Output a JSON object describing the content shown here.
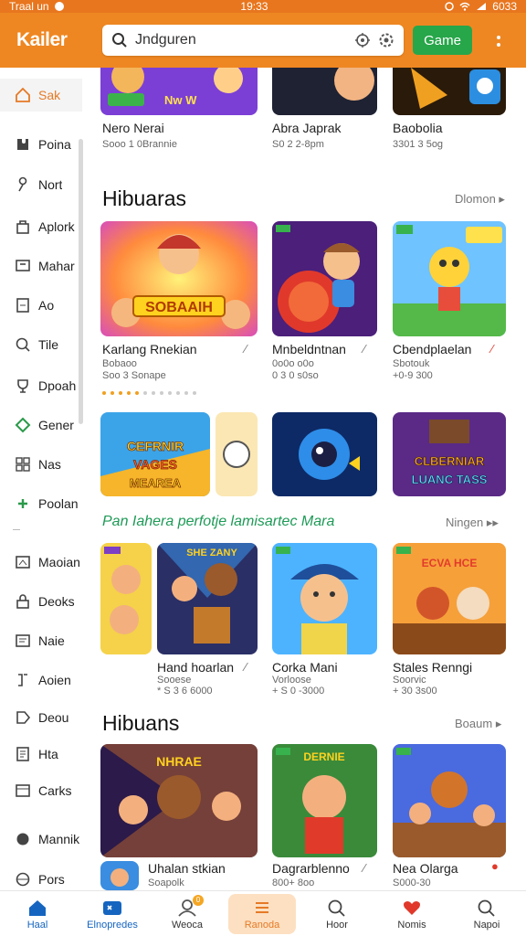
{
  "status_bar": {
    "left": "Traal un",
    "time": "19:33",
    "right": "6033"
  },
  "header": {
    "brand": "Kailer",
    "search": {
      "value": "",
      "placeholder": "Jndguren"
    },
    "game_button": "Game"
  },
  "sidebar": {
    "items": [
      {
        "label": "Sak",
        "icon": "home-icon",
        "active": true
      },
      {
        "label": "Poina",
        "icon": "puzzle-icon"
      },
      {
        "label": "Nort",
        "icon": "person-icon"
      },
      {
        "label": "Aplork",
        "icon": "bag-icon"
      },
      {
        "label": "Mahar",
        "icon": "screen-icon"
      },
      {
        "label": "Ao",
        "icon": "page-icon"
      },
      {
        "label": "Tile",
        "icon": "search-icon"
      },
      {
        "label": "Dpoah",
        "icon": "trophy-icon"
      },
      {
        "label": "Gener",
        "icon": "diamond-icon"
      },
      {
        "label": "Nas",
        "icon": "grid-icon"
      },
      {
        "label": "Poolan",
        "icon": "gamepad-icon"
      },
      {
        "label": "Maoian",
        "icon": "window-icon"
      },
      {
        "label": "Deoks",
        "icon": "lock-icon"
      },
      {
        "label": "Naie",
        "icon": "note-icon"
      },
      {
        "label": "Aoien",
        "icon": "bracket-icon"
      },
      {
        "label": "Deou",
        "icon": "tag-icon"
      },
      {
        "label": "Hta",
        "icon": "doc-icon"
      },
      {
        "label": "Carks",
        "icon": "card-icon"
      },
      {
        "label": "Mannik",
        "icon": "chat-icon"
      },
      {
        "label": "Pors",
        "icon": "globe-icon"
      }
    ]
  },
  "top_row": [
    {
      "title": "Nero Nerai",
      "sub": "Sooo 1 0Brannie"
    },
    {
      "title": "Abra Japrak",
      "sub": "S0 2 2-8pm"
    },
    {
      "title": "Baobolia",
      "sub": "3301 3 5og"
    }
  ],
  "section1": {
    "heading": "Hibuaras",
    "more": "Dlomon",
    "cards": [
      {
        "title": "Karlang Rnekian",
        "sub1": "Bobaoo",
        "sub2": "Soo 3 Sonape"
      },
      {
        "title": "Mnbeldntnan",
        "sub1": "0o0o o0o",
        "sub2": "0 3 0 s0so"
      },
      {
        "title": "Cbendplaelan",
        "sub1": "Sbotouk",
        "sub2": "+0-9 300"
      }
    ],
    "banner_text": "CEFRNIR VAGES MEAREA",
    "banner_text2": "CLBERNIAR LUANC TASS",
    "hero_text": "SOBAAIH"
  },
  "promo": {
    "heading": "Pan Iahera perfotje lamisartec Mara",
    "more": "Ningen",
    "cards": [
      {
        "title": "Hand hoarlan",
        "sub1": "Sooese",
        "sub2": "* S 3 6 6000"
      },
      {
        "title": "Corka Mani",
        "sub1": "Vorloose",
        "sub2": "+ S 0 -3000"
      },
      {
        "title": "Stales Renngi",
        "sub1": "Soorvic",
        "sub2": "+ 30 3s00"
      }
    ],
    "card_text1": "SHE ZANY",
    "card_text3": "ECVA HCE"
  },
  "section2": {
    "heading": "Hibuans",
    "more": "Boaum",
    "cards": [
      {
        "title": "Uhalan stkian",
        "sub1": "Soapolk"
      },
      {
        "title": "Dagrarblenno",
        "sub1": "800+ 8oo"
      },
      {
        "title": "Nea Olarga",
        "sub1": "S000-30"
      }
    ],
    "card_text1": "NHRAE",
    "card_text2": "DERNIE"
  },
  "bottom_nav": {
    "items": [
      {
        "label": "Haal",
        "icon": "home-icon"
      },
      {
        "label": "Elnopredes",
        "icon": "controller-icon"
      },
      {
        "label": "Weoca",
        "icon": "user-icon",
        "badge": "0"
      },
      {
        "label": "Ranoda",
        "icon": "menu-icon"
      },
      {
        "label": "Hoor",
        "icon": "search-icon"
      },
      {
        "label": "Nomis",
        "icon": "heart-icon"
      },
      {
        "label": "Napoi",
        "icon": "magnifier-icon"
      }
    ]
  },
  "colors": {
    "brand_orange": "#ee8722",
    "game_green": "#27a64a",
    "promo_green": "#1e9a57",
    "active_blue": "#1565c0"
  }
}
